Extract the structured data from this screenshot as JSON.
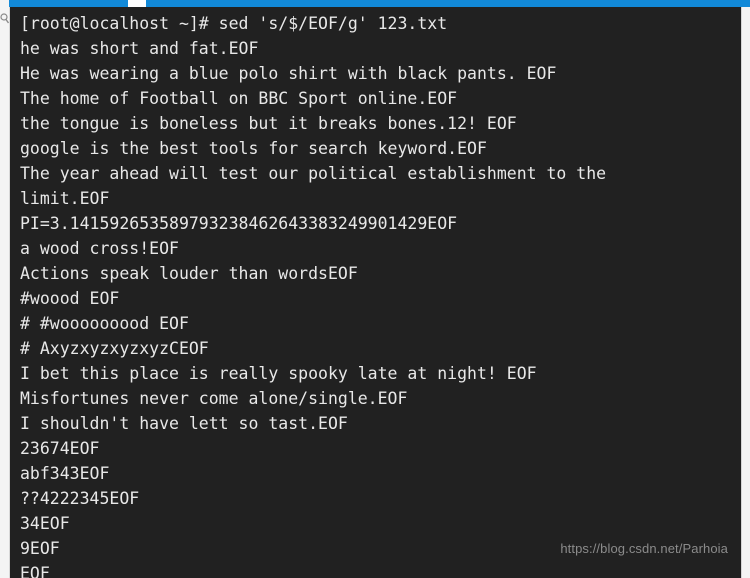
{
  "window": {
    "chrome_accent_color": "#1289d8",
    "background_color": "#212121",
    "text_color": "#e8e8e8"
  },
  "gutter": {
    "search_icon": "search-icon"
  },
  "terminal": {
    "prompt": "[root@localhost ~]#",
    "command": "sed 's/$/EOF/g' 123.txt",
    "prompt_line": "[root@localhost ~]# sed 's/$/EOF/g' 123.txt",
    "output_lines": [
      "he was short and fat.EOF",
      "He was wearing a blue polo shirt with black pants. EOF",
      "The home of Football on BBC Sport online.EOF",
      "the tongue is boneless but it breaks bones.12! EOF",
      "google is the best tools for search keyword.EOF",
      "The year ahead will test our political establishment to the",
      "limit.EOF",
      "PI=3.141592653589793238462643383249901429EOF",
      "a wood cross!EOF",
      "Actions speak louder than wordsEOF",
      "#woood EOF",
      "# #wooooooood EOF",
      "# AxyzxyzxyzxyzCEOF",
      "I bet this place is really spooky late at night! EOF",
      "Misfortunes never come alone/single.EOF",
      "I shouldn't have lett so tast.EOF",
      "23674EOF",
      "abf343EOF",
      "??4222345EOF",
      "34EOF",
      "9EOF",
      "EOF"
    ]
  },
  "watermark": {
    "text": "https://blog.csdn.net/Parhoia"
  }
}
